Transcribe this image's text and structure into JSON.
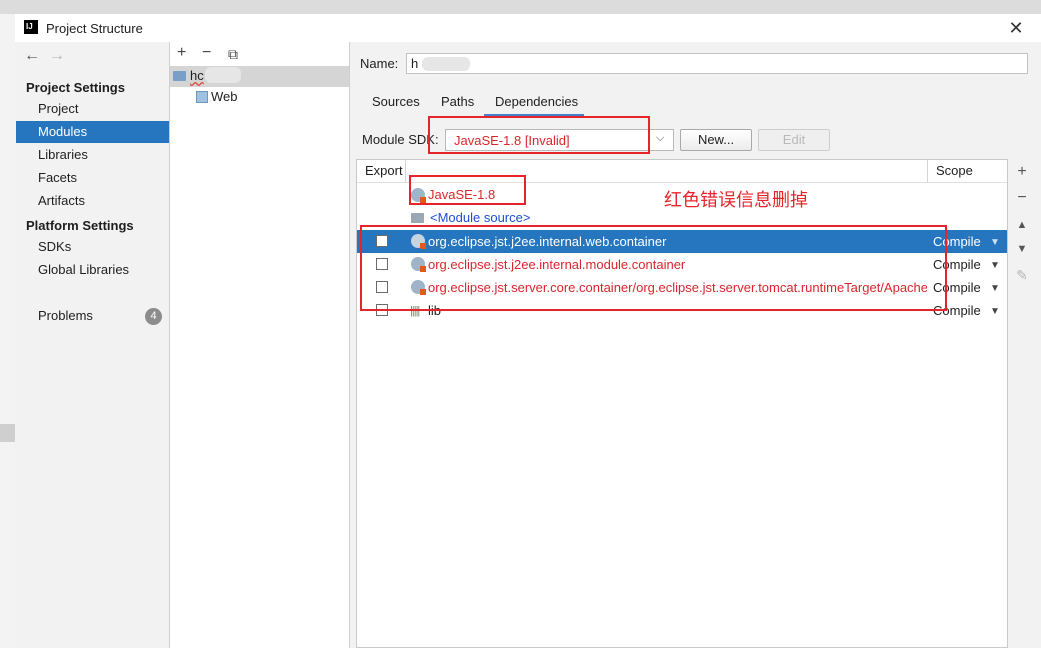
{
  "window": {
    "title": "Project Structure",
    "close_glyph": "✕"
  },
  "nav": {
    "back": "←",
    "forward": "→"
  },
  "sidebar": {
    "project_settings_heading": "Project Settings",
    "project_items": [
      "Project",
      "Modules",
      "Libraries",
      "Facets",
      "Artifacts"
    ],
    "selected_item": "Modules",
    "platform_settings_heading": "Platform Settings",
    "platform_items": [
      "SDKs",
      "Global Libraries"
    ],
    "problems_label": "Problems",
    "problems_count": "4"
  },
  "tree": {
    "toolbar": {
      "add": "+",
      "remove": "−",
      "copy": "⧉"
    },
    "module_name": "hc",
    "child": "Web"
  },
  "name_row": {
    "label": "Name:",
    "value": "h"
  },
  "tabs": {
    "items": [
      "Sources",
      "Paths",
      "Dependencies"
    ],
    "selected": "Dependencies"
  },
  "sdk_row": {
    "label": "Module SDK:",
    "value": "JavaSE-1.8 [Invalid]",
    "new_button": "New...",
    "edit_button": "Edit"
  },
  "table": {
    "headers": {
      "export": "Export",
      "scope": "Scope"
    },
    "rows": [
      {
        "name": "JavaSE-1.8",
        "scope": "",
        "checkbox": false,
        "type": "sdk"
      },
      {
        "name": "<Module source>",
        "scope": "",
        "checkbox": false,
        "type": "source"
      },
      {
        "name": "org.eclipse.jst.j2ee.internal.web.container",
        "scope": "Compile",
        "checkbox": true,
        "type": "library",
        "selected": true
      },
      {
        "name": "org.eclipse.jst.j2ee.internal.module.container",
        "scope": "Compile",
        "checkbox": true,
        "type": "library"
      },
      {
        "name": "org.eclipse.jst.server.core.container/org.eclipse.jst.server.tomcat.runtimeTarget/Apache",
        "scope": "Compile",
        "checkbox": true,
        "type": "library"
      },
      {
        "name": "lib",
        "scope": "Compile",
        "checkbox": true,
        "type": "folder"
      }
    ],
    "side_toolbar": {
      "add": "+",
      "remove": "−",
      "up": "▲",
      "down": "▼",
      "edit": "✎"
    }
  },
  "annotation": {
    "text": "红色错误信息删掉"
  },
  "colors": {
    "accent": "#2675bf",
    "error": "#d9262c",
    "annotation": "#e8242b",
    "tab_underline": "#4083c9"
  }
}
